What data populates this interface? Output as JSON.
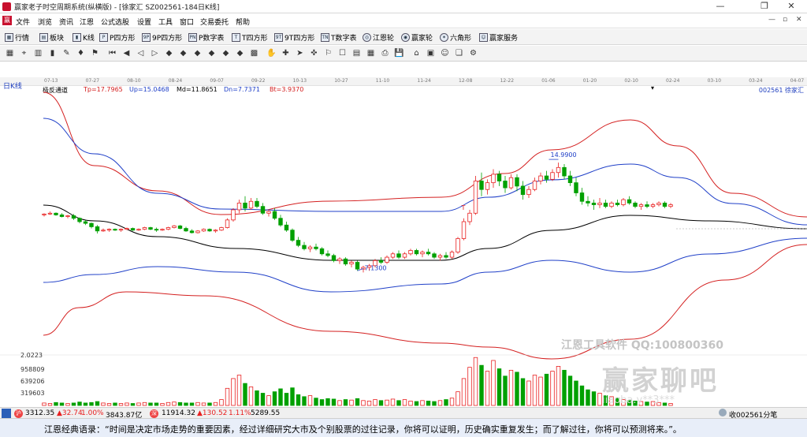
{
  "titlebar": {
    "title": "赢家老子时空周期系统(纵横版) - [徐家汇  SZ002561-184日K线]",
    "minimize": "—",
    "restore": "❐",
    "close": "✕"
  },
  "menubar": {
    "icon": "赢",
    "items": [
      "文件",
      "浏览",
      "资讯",
      "江恩",
      "公式选股",
      "设置",
      "工具",
      "窗口",
      "交易委托",
      "帮助"
    ],
    "controls": [
      "—",
      "▫",
      "✕"
    ]
  },
  "toolbar1": {
    "items": [
      "行情",
      "板块",
      "K线",
      "P四方形",
      "9P四方形",
      "P数字表",
      "T四方形",
      "9T四方形",
      "T数字表",
      "江恩轮",
      "赢家轮",
      "六角形",
      "赢家服务"
    ]
  },
  "toolbar2": {
    "icon_names": [
      "grid-icon",
      "cursor-icon",
      "bar-chart-icon",
      "candlestick-icon",
      "pen-icon",
      "drop-icon",
      "flag-icon",
      "first-icon",
      "prev-icon",
      "back-icon",
      "forward-icon",
      "diamond-icon",
      "diamond2-icon",
      "diamond3-icon",
      "diamond4-icon",
      "diamond5-icon",
      "diamond6-icon",
      "grid2-icon",
      "hand-icon",
      "cross-icon",
      "arrow-icon",
      "magnet-icon",
      "flag2-icon",
      "box-icon",
      "calendar-icon",
      "table-icon",
      "print-icon",
      "save-icon",
      "home-icon",
      "screen-icon",
      "user-icon",
      "window-icon",
      "tools-icon"
    ],
    "icon_glyphs": [
      "▦",
      "⌖",
      "▥",
      "▮",
      "✎",
      "♦",
      "⚑",
      "⏮",
      "◀",
      "◁",
      "▷",
      "◆",
      "◆",
      "◆",
      "◆",
      "◆",
      "◆",
      "▩",
      "✋",
      "✚",
      "➤",
      "✜",
      "⚐",
      "☐",
      "▤",
      "▦",
      "⎙",
      "💾",
      "⌂",
      "▣",
      "☺",
      "❏",
      "⚙"
    ]
  },
  "time_axis": [
    "07-13",
    "07-27",
    "08-10",
    "08-24",
    "09-07",
    "09-22",
    "10-13",
    "10-27",
    "11-10",
    "11-24",
    "12-08",
    "12-22",
    "01-06",
    "01-20",
    "02-10",
    "02-24",
    "03-10",
    "03-24",
    "04-07"
  ],
  "period_label": "日K线",
  "indicator": {
    "name": "极反通道",
    "tp": "Tp=17.7965",
    "up": "Up=15.0468",
    "md": "Md=11.8651",
    "dn": "Dn=7.7371",
    "bt": "Bt=3.9370"
  },
  "stock": {
    "code": "002561",
    "name": "徐家汇"
  },
  "colors": {
    "up": "#e82020",
    "down": "#00a000",
    "outer_band": "#d42020",
    "inner_band": "#2040c8",
    "mid": "#000000",
    "info_blue": "#1f3fbf"
  },
  "annotations": {
    "high_label": "14.9900",
    "low_label": "7.1300",
    "t_marker": "T"
  },
  "volume_scale": [
    "2.0223",
    "958809",
    "639206",
    "319603"
  ],
  "watermark": {
    "line1": "江恩工具软件  QQ:100800360",
    "line2": "赢家聊吧",
    "line3": "iiaoba.y**3***"
  },
  "statusbar": {
    "sh_icon": "沪",
    "sh_index": "3312.35",
    "sh_change": "▲32.74",
    "sh_pct": "1.00%",
    "sh_amount": "3843.87亿",
    "sz_icon": "深",
    "sz_index": "11914.32",
    "sz_change": "▲130.52",
    "sz_pct": "1.11%",
    "sz_amount": "5289.55",
    "right_text": "收002561分笔"
  },
  "ticker": "江恩经典语录：“时间是决定市场走势的重要因素，经过详细研究大市及个别股票的过往记录，你将可以证明，历史确实重复发生；而了解过往，你将可以预测将来。”。",
  "chart_data": {
    "type": "candlestick",
    "title": "",
    "xlabel": "",
    "ylabel": "",
    "y_range": [
      4.0,
      19.0
    ],
    "x_ticks": [
      "07-13",
      "07-27",
      "08-10",
      "08-24",
      "09-07",
      "09-22",
      "10-13",
      "10-27",
      "11-10",
      "11-24",
      "12-08",
      "12-22",
      "01-06",
      "01-20",
      "02-10",
      "02-24",
      "03-10",
      "03-24",
      "04-07"
    ],
    "ohlc": [
      [
        11.9,
        12.0,
        11.8,
        11.95
      ],
      [
        11.95,
        12.1,
        11.9,
        12.0
      ],
      [
        12.0,
        12.05,
        11.85,
        11.9
      ],
      [
        11.9,
        12.0,
        11.75,
        11.8
      ],
      [
        11.8,
        11.9,
        11.7,
        11.85
      ],
      [
        11.85,
        11.95,
        11.6,
        11.7
      ],
      [
        11.7,
        11.75,
        11.4,
        11.5
      ],
      [
        11.5,
        11.6,
        11.3,
        11.4
      ],
      [
        11.4,
        11.45,
        11.1,
        11.2
      ],
      [
        11.2,
        11.3,
        10.8,
        10.95
      ],
      [
        10.95,
        11.1,
        10.9,
        11.0
      ],
      [
        11.0,
        11.1,
        10.9,
        11.05
      ],
      [
        11.05,
        11.1,
        10.95,
        11.0
      ],
      [
        11.0,
        11.1,
        10.9,
        11.05
      ],
      [
        11.05,
        11.15,
        11.0,
        11.1
      ],
      [
        11.1,
        11.15,
        10.95,
        11.0
      ],
      [
        11.0,
        11.1,
        10.95,
        11.05
      ],
      [
        11.05,
        11.2,
        11.0,
        11.15
      ],
      [
        11.15,
        11.2,
        11.0,
        11.05
      ],
      [
        11.05,
        11.15,
        10.9,
        11.0
      ],
      [
        11.0,
        11.1,
        10.95,
        11.05
      ],
      [
        11.05,
        11.2,
        11.0,
        11.15
      ],
      [
        11.15,
        11.3,
        11.1,
        11.25
      ],
      [
        11.25,
        11.3,
        11.05,
        11.1
      ],
      [
        11.1,
        11.2,
        10.9,
        10.95
      ],
      [
        10.95,
        11.05,
        10.8,
        10.85
      ],
      [
        10.85,
        11.0,
        10.8,
        10.95
      ],
      [
        10.95,
        11.1,
        10.9,
        11.05
      ],
      [
        11.05,
        11.1,
        10.9,
        10.95
      ],
      [
        10.95,
        11.05,
        10.85,
        11.0
      ],
      [
        11.0,
        11.2,
        10.95,
        11.15
      ],
      [
        11.15,
        11.7,
        11.1,
        11.6
      ],
      [
        11.6,
        12.3,
        11.5,
        12.2
      ],
      [
        12.2,
        12.8,
        12.0,
        12.6
      ],
      [
        12.6,
        13.0,
        12.1,
        12.3
      ],
      [
        12.3,
        12.9,
        12.2,
        12.7
      ],
      [
        12.7,
        12.9,
        12.3,
        12.4
      ],
      [
        12.4,
        12.6,
        11.9,
        12.0
      ],
      [
        12.0,
        12.2,
        11.8,
        12.1
      ],
      [
        12.1,
        12.3,
        11.6,
        11.7
      ],
      [
        11.7,
        11.9,
        11.2,
        11.3
      ],
      [
        11.3,
        11.5,
        10.9,
        11.0
      ],
      [
        11.0,
        11.1,
        10.3,
        10.4
      ],
      [
        10.4,
        10.6,
        10.0,
        10.1
      ],
      [
        10.1,
        10.3,
        9.8,
        9.9
      ],
      [
        9.9,
        10.1,
        9.7,
        10.0
      ],
      [
        10.0,
        10.2,
        9.8,
        9.9
      ],
      [
        9.9,
        10.0,
        9.5,
        9.6
      ],
      [
        9.6,
        9.8,
        9.4,
        9.5
      ],
      [
        9.5,
        9.6,
        9.1,
        9.2
      ],
      [
        9.2,
        9.4,
        9.0,
        9.3
      ],
      [
        9.3,
        9.4,
        8.9,
        9.0
      ],
      [
        9.0,
        9.2,
        8.8,
        9.1
      ],
      [
        9.1,
        9.2,
        8.6,
        8.7
      ],
      [
        8.7,
        8.9,
        8.5,
        8.8
      ],
      [
        8.8,
        9.0,
        8.6,
        8.9
      ],
      [
        8.9,
        9.3,
        8.8,
        9.2
      ],
      [
        9.2,
        9.4,
        9.0,
        9.1
      ],
      [
        9.1,
        9.5,
        9.0,
        9.4
      ],
      [
        9.4,
        9.7,
        9.3,
        9.6
      ],
      [
        9.6,
        9.8,
        9.3,
        9.4
      ],
      [
        9.4,
        9.7,
        9.3,
        9.6
      ],
      [
        9.6,
        9.9,
        9.5,
        9.8
      ],
      [
        9.8,
        9.9,
        9.5,
        9.6
      ],
      [
        9.6,
        9.8,
        9.4,
        9.7
      ],
      [
        9.7,
        9.9,
        9.5,
        9.6
      ],
      [
        9.6,
        9.7,
        9.3,
        9.4
      ],
      [
        9.4,
        9.6,
        9.2,
        9.5
      ],
      [
        9.5,
        9.7,
        9.3,
        9.4
      ],
      [
        9.4,
        9.8,
        9.3,
        9.7
      ],
      [
        9.7,
        10.6,
        9.6,
        10.5
      ],
      [
        10.5,
        11.7,
        10.4,
        11.5
      ],
      [
        11.5,
        12.2,
        11.3,
        12.0
      ],
      [
        12.0,
        14.2,
        11.9,
        13.9
      ],
      [
        13.9,
        14.4,
        13.0,
        13.4
      ],
      [
        13.4,
        14.0,
        13.1,
        13.8
      ],
      [
        13.8,
        14.6,
        13.5,
        14.3
      ],
      [
        14.3,
        14.5,
        13.6,
        13.9
      ],
      [
        13.9,
        14.2,
        13.2,
        13.5
      ],
      [
        13.5,
        14.3,
        13.4,
        14.1
      ],
      [
        14.1,
        14.3,
        13.3,
        13.6
      ],
      [
        13.6,
        13.9,
        12.8,
        13.1
      ],
      [
        13.1,
        13.6,
        12.9,
        13.4
      ],
      [
        13.4,
        14.1,
        13.3,
        13.9
      ],
      [
        13.9,
        14.4,
        13.7,
        14.2
      ],
      [
        14.2,
        14.5,
        13.8,
        14.0
      ],
      [
        14.0,
        14.6,
        13.9,
        14.4
      ],
      [
        14.4,
        14.99,
        14.1,
        14.7
      ],
      [
        14.7,
        14.9,
        14.0,
        14.2
      ],
      [
        14.2,
        14.5,
        13.6,
        13.8
      ],
      [
        13.8,
        14.1,
        13.0,
        13.2
      ],
      [
        13.2,
        13.5,
        12.5,
        12.7
      ],
      [
        12.7,
        13.0,
        12.4,
        12.6
      ],
      [
        12.6,
        12.8,
        12.2,
        12.5
      ],
      [
        12.5,
        12.9,
        12.3,
        12.6
      ],
      [
        12.6,
        12.8,
        12.3,
        12.4
      ],
      [
        12.4,
        12.7,
        12.3,
        12.6
      ],
      [
        12.6,
        12.8,
        12.4,
        12.5
      ],
      [
        12.5,
        12.9,
        12.4,
        12.8
      ],
      [
        12.8,
        13.0,
        12.5,
        12.6
      ],
      [
        12.6,
        12.7,
        12.3,
        12.4
      ],
      [
        12.4,
        12.6,
        12.2,
        12.5
      ],
      [
        12.5,
        12.7,
        12.3,
        12.4
      ],
      [
        12.4,
        12.6,
        12.3,
        12.5
      ],
      [
        12.5,
        12.7,
        12.4,
        12.6
      ],
      [
        12.6,
        12.7,
        12.3,
        12.4
      ],
      [
        12.4,
        12.6,
        12.3,
        12.5
      ]
    ],
    "volume": [
      0.05,
      0.04,
      0.06,
      0.05,
      0.04,
      0.05,
      0.07,
      0.05,
      0.06,
      0.08,
      0.05,
      0.04,
      0.05,
      0.04,
      0.05,
      0.04,
      0.05,
      0.06,
      0.05,
      0.05,
      0.04,
      0.06,
      0.07,
      0.06,
      0.05,
      0.05,
      0.06,
      0.05,
      0.05,
      0.06,
      0.12,
      0.35,
      0.55,
      0.62,
      0.45,
      0.38,
      0.3,
      0.25,
      0.2,
      0.28,
      0.34,
      0.25,
      0.36,
      0.22,
      0.18,
      0.2,
      0.15,
      0.12,
      0.14,
      0.13,
      0.1,
      0.12,
      0.11,
      0.14,
      0.1,
      0.09,
      0.12,
      0.1,
      0.11,
      0.13,
      0.1,
      0.12,
      0.09,
      0.08,
      0.1,
      0.09,
      0.08,
      0.1,
      0.12,
      0.15,
      0.28,
      0.55,
      0.78,
      0.98,
      0.82,
      0.7,
      0.92,
      0.75,
      0.6,
      0.72,
      0.68,
      0.55,
      0.5,
      0.62,
      0.58,
      0.64,
      0.7,
      0.8,
      0.72,
      0.6,
      0.5,
      0.4,
      0.32,
      0.28,
      0.25,
      0.2,
      0.18,
      0.15,
      0.12,
      0.1,
      0.09,
      0.08,
      0.07,
      0.08,
      0.06,
      0.05,
      0.04
    ],
    "bands": {
      "top_outer": [
        [
          55,
          117
        ],
        [
          120,
          210
        ],
        [
          200,
          242
        ],
        [
          280,
          272
        ],
        [
          420,
          255
        ],
        [
          560,
          250
        ],
        [
          640,
          220
        ],
        [
          700,
          190
        ],
        [
          800,
          152
        ],
        [
          860,
          185
        ],
        [
          930,
          245
        ],
        [
          1024,
          275
        ]
      ],
      "top_inner": [
        [
          55,
          150
        ],
        [
          120,
          195
        ],
        [
          200,
          245
        ],
        [
          280,
          265
        ],
        [
          420,
          268
        ],
        [
          560,
          268
        ],
        [
          620,
          250
        ],
        [
          700,
          228
        ],
        [
          800,
          208
        ],
        [
          860,
          225
        ],
        [
          930,
          258
        ],
        [
          1024,
          285
        ]
      ],
      "mid": [
        [
          55,
          260
        ],
        [
          120,
          280
        ],
        [
          200,
          300
        ],
        [
          300,
          315
        ],
        [
          420,
          330
        ],
        [
          560,
          330
        ],
        [
          620,
          315
        ],
        [
          700,
          292
        ],
        [
          800,
          273
        ],
        [
          900,
          280
        ],
        [
          1024,
          290
        ]
      ],
      "bot_inner": [
        [
          55,
          358
        ],
        [
          120,
          348
        ],
        [
          200,
          338
        ],
        [
          300,
          345
        ],
        [
          420,
          370
        ],
        [
          560,
          360
        ],
        [
          620,
          345
        ],
        [
          700,
          330
        ],
        [
          800,
          345
        ],
        [
          900,
          322
        ],
        [
          1024,
          302
        ]
      ],
      "bot_outer": [
        [
          55,
          425
        ],
        [
          100,
          390
        ],
        [
          160,
          370
        ],
        [
          260,
          375
        ],
        [
          420,
          420
        ],
        [
          560,
          435
        ],
        [
          620,
          440
        ],
        [
          700,
          455
        ],
        [
          800,
          430
        ],
        [
          920,
          355
        ],
        [
          1024,
          310
        ]
      ]
    }
  }
}
